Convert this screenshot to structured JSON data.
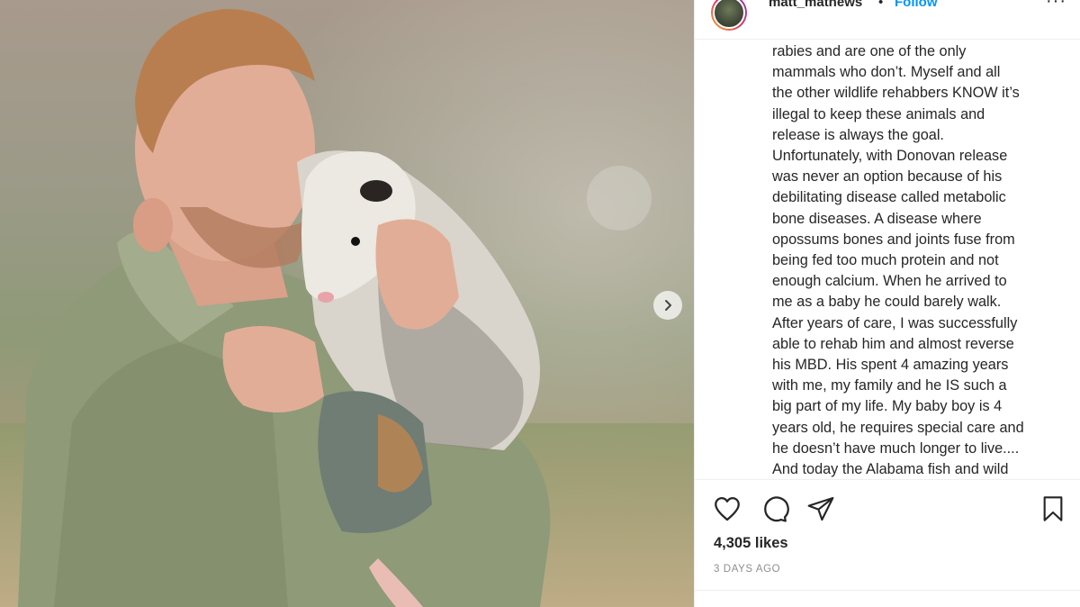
{
  "post": {
    "username": "matt_mathews",
    "separator": "•",
    "follow_label": "Follow",
    "more_label": "···",
    "caption_lines": [
      "rabies and are one of the only",
      "mammals who don’t. Myself and all",
      "the other wildlife rehabbers KNOW it’s",
      "illegal to keep these animals and",
      "release is always the goal.",
      "Unfortunately, with Donovan release",
      "was never an option because of his",
      "debilitating disease called metabolic",
      "bone diseases. A disease where",
      "opossums bones and joints fuse from",
      "being fed too much protein and not",
      "enough calcium. When he arrived to",
      "me as a baby he could barely walk.",
      "After years of care, I was successfully",
      "able to rehab him and almost reverse",
      "his MBD. His spent 4 amazing years",
      "with me, my family and he IS such a",
      "big part of my life. My baby boy is 4",
      "years old, he requires special care and",
      "he doesn’t have much longer to live....",
      "And today the Alabama fish and wild"
    ],
    "likes": "4,305 likes",
    "timestamp": "3 DAYS AGO"
  },
  "icons": {
    "like": "heart-icon",
    "comment": "comment-icon",
    "share": "share-icon",
    "save": "bookmark-icon",
    "next": "chevron-right-icon"
  },
  "colors": {
    "follow": "#0095f6",
    "text": "#262626",
    "muted": "#8e8e8e",
    "border": "#efefef"
  }
}
